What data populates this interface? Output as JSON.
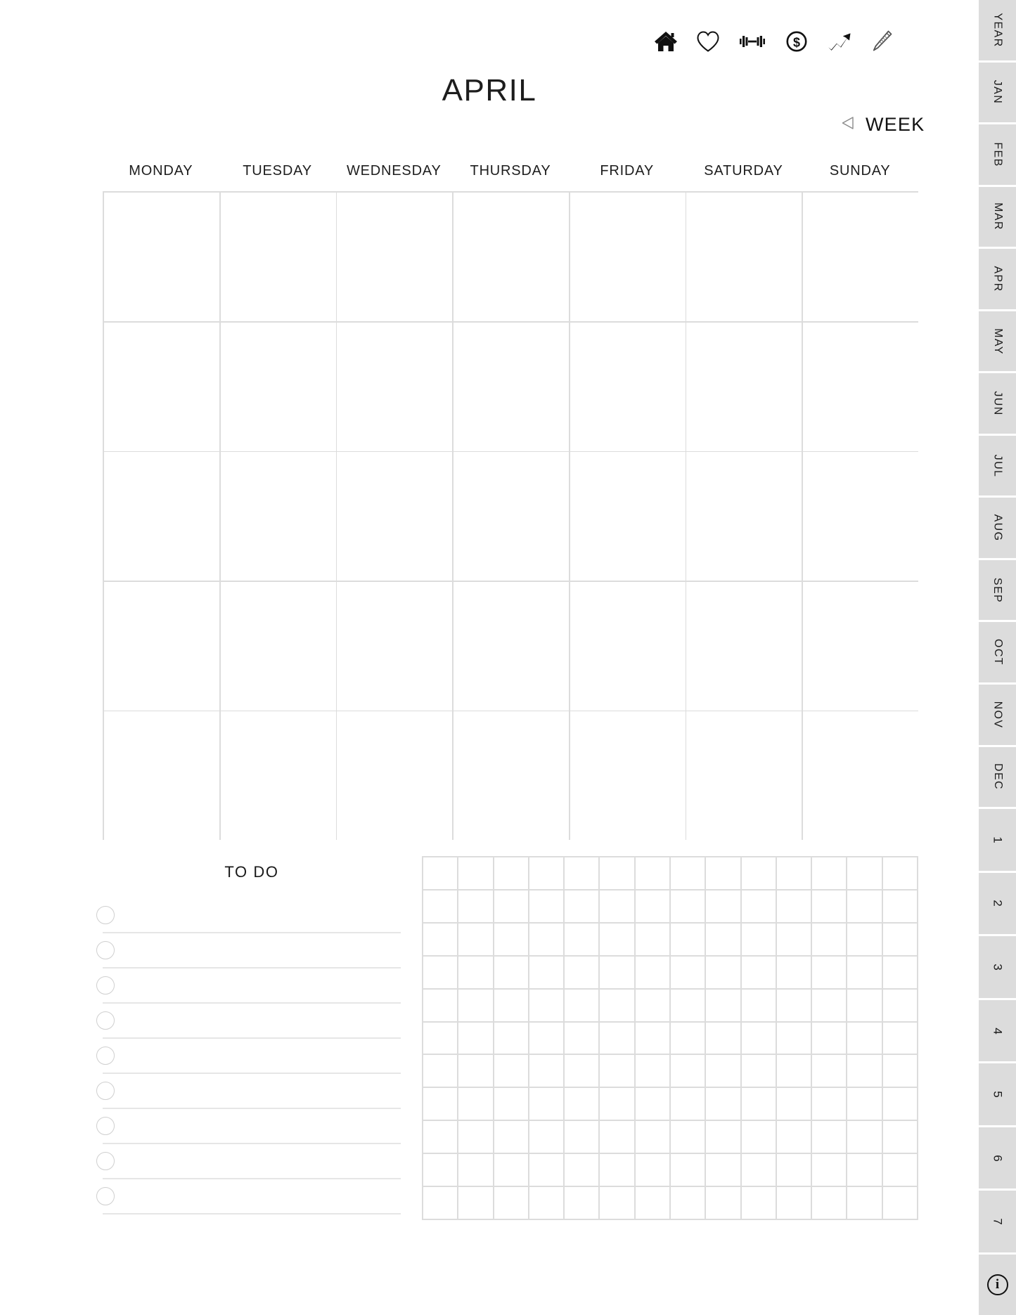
{
  "header": {
    "month_title": "APRIL",
    "icons": [
      {
        "name": "home-icon",
        "label": "Home"
      },
      {
        "name": "heart-icon",
        "label": "Health"
      },
      {
        "name": "dumbbell-icon",
        "label": "Fitness"
      },
      {
        "name": "dollar-coin-icon",
        "label": "Finance"
      },
      {
        "name": "trending-up-icon",
        "label": "Progress"
      },
      {
        "name": "pencil-icon",
        "label": "Notes"
      }
    ]
  },
  "week_nav": {
    "arrow_icon": "triangle-left-icon",
    "label": "WEEK"
  },
  "calendar": {
    "weekdays": [
      "MONDAY",
      "TUESDAY",
      "WEDNESDAY",
      "THURSDAY",
      "FRIDAY",
      "SATURDAY",
      "SUNDAY"
    ],
    "rows": 5,
    "columns": 7,
    "cells": [
      "",
      "",
      "",
      "",
      "",
      "",
      "",
      "",
      "",
      "",
      "",
      "",
      "",
      "",
      "",
      "",
      "",
      "",
      "",
      "",
      "",
      "",
      "",
      "",
      "",
      "",
      "",
      "",
      "",
      "",
      "",
      "",
      "",
      "",
      ""
    ]
  },
  "todo": {
    "title": "TO DO",
    "items": [
      "",
      "",
      "",
      "",
      "",
      "",
      "",
      "",
      ""
    ]
  },
  "notes_grid": {
    "columns": 14,
    "rows": 11
  },
  "tabstrip": {
    "tabs": [
      {
        "label": "YEAR",
        "type": "text"
      },
      {
        "label": "JAN",
        "type": "text"
      },
      {
        "label": "FEB",
        "type": "text"
      },
      {
        "label": "MAR",
        "type": "text"
      },
      {
        "label": "APR",
        "type": "text"
      },
      {
        "label": "MAY",
        "type": "text"
      },
      {
        "label": "JUN",
        "type": "text"
      },
      {
        "label": "JUL",
        "type": "text"
      },
      {
        "label": "AUG",
        "type": "text"
      },
      {
        "label": "SEP",
        "type": "text"
      },
      {
        "label": "OCT",
        "type": "text"
      },
      {
        "label": "NOV",
        "type": "text"
      },
      {
        "label": "DEC",
        "type": "text"
      },
      {
        "label": "1",
        "type": "num"
      },
      {
        "label": "2",
        "type": "num"
      },
      {
        "label": "3",
        "type": "num"
      },
      {
        "label": "4",
        "type": "num"
      },
      {
        "label": "5",
        "type": "num"
      },
      {
        "label": "6",
        "type": "num"
      },
      {
        "label": "7",
        "type": "num"
      }
    ],
    "info_tab": {
      "icon": "info-icon",
      "label": "i"
    }
  },
  "colors": {
    "tab_background": "#dcdcdc",
    "grid_line": "#dcdcdc",
    "rule_line": "#e6e6e6",
    "text": "#1a1a1a",
    "page_background": "#ffffff"
  }
}
